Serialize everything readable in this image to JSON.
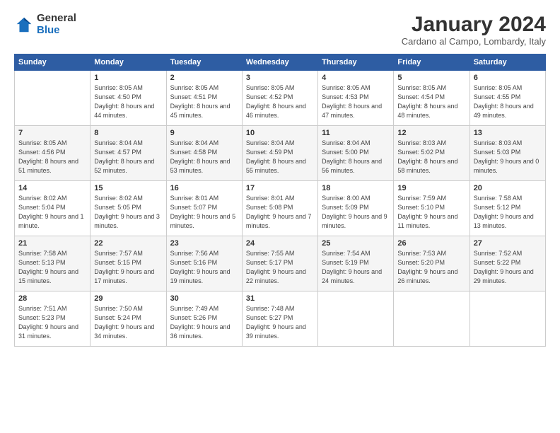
{
  "logo": {
    "general": "General",
    "blue": "Blue"
  },
  "header": {
    "title": "January 2024",
    "subtitle": "Cardano al Campo, Lombardy, Italy"
  },
  "days_of_week": [
    "Sunday",
    "Monday",
    "Tuesday",
    "Wednesday",
    "Thursday",
    "Friday",
    "Saturday"
  ],
  "weeks": [
    [
      {
        "day": "",
        "sunrise": "",
        "sunset": "",
        "daylight": ""
      },
      {
        "day": "1",
        "sunrise": "Sunrise: 8:05 AM",
        "sunset": "Sunset: 4:50 PM",
        "daylight": "Daylight: 8 hours and 44 minutes."
      },
      {
        "day": "2",
        "sunrise": "Sunrise: 8:05 AM",
        "sunset": "Sunset: 4:51 PM",
        "daylight": "Daylight: 8 hours and 45 minutes."
      },
      {
        "day": "3",
        "sunrise": "Sunrise: 8:05 AM",
        "sunset": "Sunset: 4:52 PM",
        "daylight": "Daylight: 8 hours and 46 minutes."
      },
      {
        "day": "4",
        "sunrise": "Sunrise: 8:05 AM",
        "sunset": "Sunset: 4:53 PM",
        "daylight": "Daylight: 8 hours and 47 minutes."
      },
      {
        "day": "5",
        "sunrise": "Sunrise: 8:05 AM",
        "sunset": "Sunset: 4:54 PM",
        "daylight": "Daylight: 8 hours and 48 minutes."
      },
      {
        "day": "6",
        "sunrise": "Sunrise: 8:05 AM",
        "sunset": "Sunset: 4:55 PM",
        "daylight": "Daylight: 8 hours and 49 minutes."
      }
    ],
    [
      {
        "day": "7",
        "sunrise": "Sunrise: 8:05 AM",
        "sunset": "Sunset: 4:56 PM",
        "daylight": "Daylight: 8 hours and 51 minutes."
      },
      {
        "day": "8",
        "sunrise": "Sunrise: 8:04 AM",
        "sunset": "Sunset: 4:57 PM",
        "daylight": "Daylight: 8 hours and 52 minutes."
      },
      {
        "day": "9",
        "sunrise": "Sunrise: 8:04 AM",
        "sunset": "Sunset: 4:58 PM",
        "daylight": "Daylight: 8 hours and 53 minutes."
      },
      {
        "day": "10",
        "sunrise": "Sunrise: 8:04 AM",
        "sunset": "Sunset: 4:59 PM",
        "daylight": "Daylight: 8 hours and 55 minutes."
      },
      {
        "day": "11",
        "sunrise": "Sunrise: 8:04 AM",
        "sunset": "Sunset: 5:00 PM",
        "daylight": "Daylight: 8 hours and 56 minutes."
      },
      {
        "day": "12",
        "sunrise": "Sunrise: 8:03 AM",
        "sunset": "Sunset: 5:02 PM",
        "daylight": "Daylight: 8 hours and 58 minutes."
      },
      {
        "day": "13",
        "sunrise": "Sunrise: 8:03 AM",
        "sunset": "Sunset: 5:03 PM",
        "daylight": "Daylight: 9 hours and 0 minutes."
      }
    ],
    [
      {
        "day": "14",
        "sunrise": "Sunrise: 8:02 AM",
        "sunset": "Sunset: 5:04 PM",
        "daylight": "Daylight: 9 hours and 1 minute."
      },
      {
        "day": "15",
        "sunrise": "Sunrise: 8:02 AM",
        "sunset": "Sunset: 5:05 PM",
        "daylight": "Daylight: 9 hours and 3 minutes."
      },
      {
        "day": "16",
        "sunrise": "Sunrise: 8:01 AM",
        "sunset": "Sunset: 5:07 PM",
        "daylight": "Daylight: 9 hours and 5 minutes."
      },
      {
        "day": "17",
        "sunrise": "Sunrise: 8:01 AM",
        "sunset": "Sunset: 5:08 PM",
        "daylight": "Daylight: 9 hours and 7 minutes."
      },
      {
        "day": "18",
        "sunrise": "Sunrise: 8:00 AM",
        "sunset": "Sunset: 5:09 PM",
        "daylight": "Daylight: 9 hours and 9 minutes."
      },
      {
        "day": "19",
        "sunrise": "Sunrise: 7:59 AM",
        "sunset": "Sunset: 5:10 PM",
        "daylight": "Daylight: 9 hours and 11 minutes."
      },
      {
        "day": "20",
        "sunrise": "Sunrise: 7:58 AM",
        "sunset": "Sunset: 5:12 PM",
        "daylight": "Daylight: 9 hours and 13 minutes."
      }
    ],
    [
      {
        "day": "21",
        "sunrise": "Sunrise: 7:58 AM",
        "sunset": "Sunset: 5:13 PM",
        "daylight": "Daylight: 9 hours and 15 minutes."
      },
      {
        "day": "22",
        "sunrise": "Sunrise: 7:57 AM",
        "sunset": "Sunset: 5:15 PM",
        "daylight": "Daylight: 9 hours and 17 minutes."
      },
      {
        "day": "23",
        "sunrise": "Sunrise: 7:56 AM",
        "sunset": "Sunset: 5:16 PM",
        "daylight": "Daylight: 9 hours and 19 minutes."
      },
      {
        "day": "24",
        "sunrise": "Sunrise: 7:55 AM",
        "sunset": "Sunset: 5:17 PM",
        "daylight": "Daylight: 9 hours and 22 minutes."
      },
      {
        "day": "25",
        "sunrise": "Sunrise: 7:54 AM",
        "sunset": "Sunset: 5:19 PM",
        "daylight": "Daylight: 9 hours and 24 minutes."
      },
      {
        "day": "26",
        "sunrise": "Sunrise: 7:53 AM",
        "sunset": "Sunset: 5:20 PM",
        "daylight": "Daylight: 9 hours and 26 minutes."
      },
      {
        "day": "27",
        "sunrise": "Sunrise: 7:52 AM",
        "sunset": "Sunset: 5:22 PM",
        "daylight": "Daylight: 9 hours and 29 minutes."
      }
    ],
    [
      {
        "day": "28",
        "sunrise": "Sunrise: 7:51 AM",
        "sunset": "Sunset: 5:23 PM",
        "daylight": "Daylight: 9 hours and 31 minutes."
      },
      {
        "day": "29",
        "sunrise": "Sunrise: 7:50 AM",
        "sunset": "Sunset: 5:24 PM",
        "daylight": "Daylight: 9 hours and 34 minutes."
      },
      {
        "day": "30",
        "sunrise": "Sunrise: 7:49 AM",
        "sunset": "Sunset: 5:26 PM",
        "daylight": "Daylight: 9 hours and 36 minutes."
      },
      {
        "day": "31",
        "sunrise": "Sunrise: 7:48 AM",
        "sunset": "Sunset: 5:27 PM",
        "daylight": "Daylight: 9 hours and 39 minutes."
      },
      {
        "day": "",
        "sunrise": "",
        "sunset": "",
        "daylight": ""
      },
      {
        "day": "",
        "sunrise": "",
        "sunset": "",
        "daylight": ""
      },
      {
        "day": "",
        "sunrise": "",
        "sunset": "",
        "daylight": ""
      }
    ]
  ]
}
